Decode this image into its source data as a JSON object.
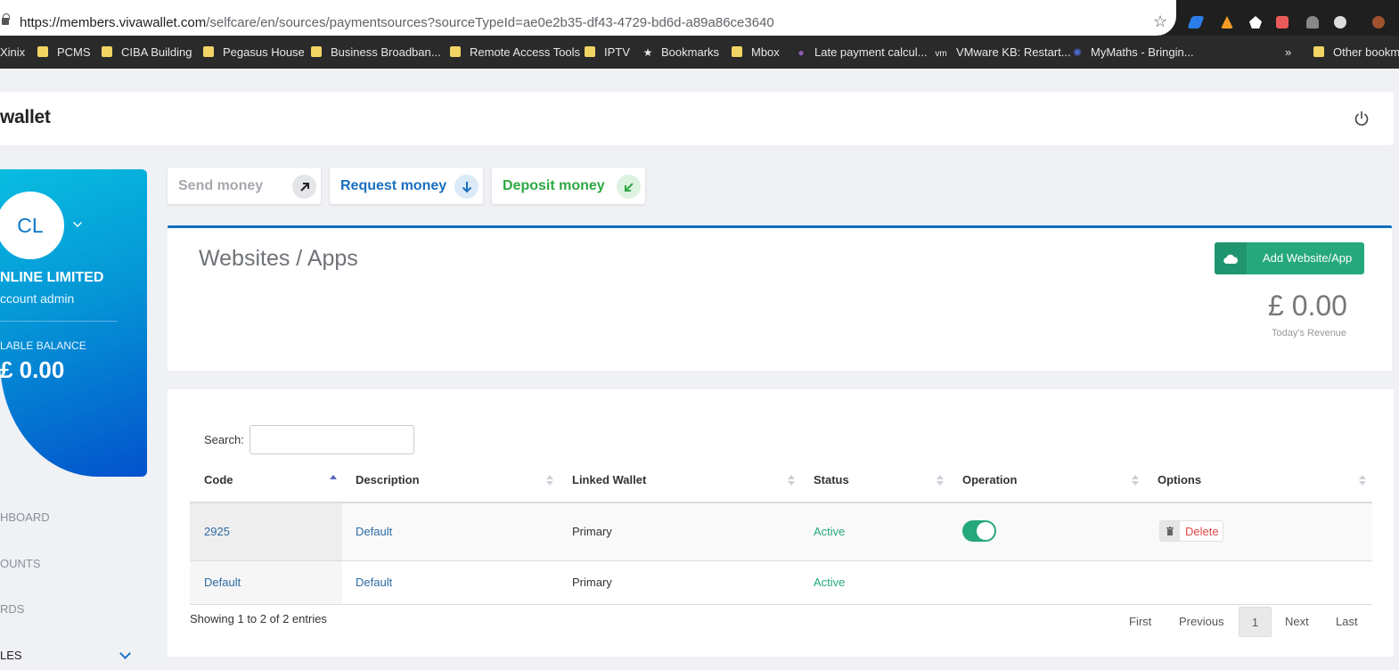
{
  "browser": {
    "url_host": "https://members.vivawallet.com",
    "url_path": "/selfcare/en/sources/paymentsources?sourceTypeId=ae0e2b35-df43-4729-bd6d-a89a86ce3640",
    "bookmarks": [
      "Xinix",
      "PCMS",
      "CIBA Building",
      "Pegasus House",
      "Business Broadban...",
      "Remote Access Tools",
      "IPTV",
      "Bookmarks",
      "Mbox",
      "Late payment calcul...",
      "VMware KB: Restart...",
      "MyMaths - Bringin...",
      "»",
      "Other bookm"
    ],
    "vm_badge": "vm"
  },
  "header": {
    "logo": "wallet"
  },
  "sidebar": {
    "avatar_initials": "CL",
    "company": "NLINE LIMITED",
    "role": "ccount admin",
    "balance_label": "LABLE BALANCE",
    "balance_value": "£ 0.00",
    "nav": [
      "HBOARD",
      "OUNTS",
      "RDS",
      "LES"
    ]
  },
  "quick_actions": {
    "send": "Send money",
    "request": "Request money",
    "deposit": "Deposit money"
  },
  "page": {
    "title": "Websites / Apps",
    "add_button": "Add Website/App",
    "revenue_value": "£ 0.00",
    "revenue_label": "Today's Revenue"
  },
  "table": {
    "search_label": "Search:",
    "search_value": "",
    "columns": [
      "Code",
      "Description",
      "Linked Wallet",
      "Status",
      "Operation",
      "Options"
    ],
    "rows": [
      {
        "code": "2925",
        "description": "Default",
        "wallet": "Primary",
        "status": "Active",
        "operation_on": true,
        "option": "Delete"
      },
      {
        "code": "Default",
        "description": "Default",
        "wallet": "Primary",
        "status": "Active",
        "operation_on": null,
        "option": ""
      }
    ],
    "info": "Showing 1 to 2 of 2 entries",
    "pagination": {
      "first": "First",
      "previous": "Previous",
      "current": "1",
      "next": "Next",
      "last": "Last"
    }
  },
  "colors": {
    "accent_blue": "#0d6fbf",
    "success_green": "#25a87c",
    "danger_red": "#e04848"
  }
}
